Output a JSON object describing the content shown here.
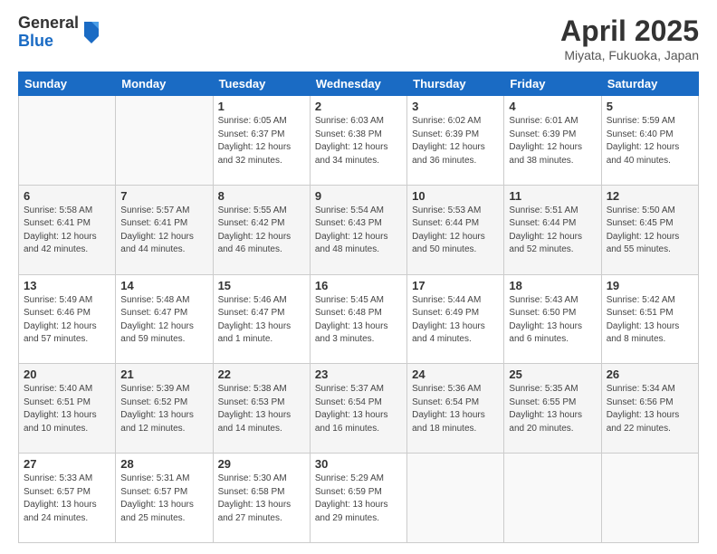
{
  "header": {
    "logo_general": "General",
    "logo_blue": "Blue",
    "title": "April 2025",
    "location": "Miyata, Fukuoka, Japan"
  },
  "columns": [
    "Sunday",
    "Monday",
    "Tuesday",
    "Wednesday",
    "Thursday",
    "Friday",
    "Saturday"
  ],
  "weeks": [
    [
      {
        "day": "",
        "info": ""
      },
      {
        "day": "",
        "info": ""
      },
      {
        "day": "1",
        "info": "Sunrise: 6:05 AM\nSunset: 6:37 PM\nDaylight: 12 hours\nand 32 minutes."
      },
      {
        "day": "2",
        "info": "Sunrise: 6:03 AM\nSunset: 6:38 PM\nDaylight: 12 hours\nand 34 minutes."
      },
      {
        "day": "3",
        "info": "Sunrise: 6:02 AM\nSunset: 6:39 PM\nDaylight: 12 hours\nand 36 minutes."
      },
      {
        "day": "4",
        "info": "Sunrise: 6:01 AM\nSunset: 6:39 PM\nDaylight: 12 hours\nand 38 minutes."
      },
      {
        "day": "5",
        "info": "Sunrise: 5:59 AM\nSunset: 6:40 PM\nDaylight: 12 hours\nand 40 minutes."
      }
    ],
    [
      {
        "day": "6",
        "info": "Sunrise: 5:58 AM\nSunset: 6:41 PM\nDaylight: 12 hours\nand 42 minutes."
      },
      {
        "day": "7",
        "info": "Sunrise: 5:57 AM\nSunset: 6:41 PM\nDaylight: 12 hours\nand 44 minutes."
      },
      {
        "day": "8",
        "info": "Sunrise: 5:55 AM\nSunset: 6:42 PM\nDaylight: 12 hours\nand 46 minutes."
      },
      {
        "day": "9",
        "info": "Sunrise: 5:54 AM\nSunset: 6:43 PM\nDaylight: 12 hours\nand 48 minutes."
      },
      {
        "day": "10",
        "info": "Sunrise: 5:53 AM\nSunset: 6:44 PM\nDaylight: 12 hours\nand 50 minutes."
      },
      {
        "day": "11",
        "info": "Sunrise: 5:51 AM\nSunset: 6:44 PM\nDaylight: 12 hours\nand 52 minutes."
      },
      {
        "day": "12",
        "info": "Sunrise: 5:50 AM\nSunset: 6:45 PM\nDaylight: 12 hours\nand 55 minutes."
      }
    ],
    [
      {
        "day": "13",
        "info": "Sunrise: 5:49 AM\nSunset: 6:46 PM\nDaylight: 12 hours\nand 57 minutes."
      },
      {
        "day": "14",
        "info": "Sunrise: 5:48 AM\nSunset: 6:47 PM\nDaylight: 12 hours\nand 59 minutes."
      },
      {
        "day": "15",
        "info": "Sunrise: 5:46 AM\nSunset: 6:47 PM\nDaylight: 13 hours\nand 1 minute."
      },
      {
        "day": "16",
        "info": "Sunrise: 5:45 AM\nSunset: 6:48 PM\nDaylight: 13 hours\nand 3 minutes."
      },
      {
        "day": "17",
        "info": "Sunrise: 5:44 AM\nSunset: 6:49 PM\nDaylight: 13 hours\nand 4 minutes."
      },
      {
        "day": "18",
        "info": "Sunrise: 5:43 AM\nSunset: 6:50 PM\nDaylight: 13 hours\nand 6 minutes."
      },
      {
        "day": "19",
        "info": "Sunrise: 5:42 AM\nSunset: 6:51 PM\nDaylight: 13 hours\nand 8 minutes."
      }
    ],
    [
      {
        "day": "20",
        "info": "Sunrise: 5:40 AM\nSunset: 6:51 PM\nDaylight: 13 hours\nand 10 minutes."
      },
      {
        "day": "21",
        "info": "Sunrise: 5:39 AM\nSunset: 6:52 PM\nDaylight: 13 hours\nand 12 minutes."
      },
      {
        "day": "22",
        "info": "Sunrise: 5:38 AM\nSunset: 6:53 PM\nDaylight: 13 hours\nand 14 minutes."
      },
      {
        "day": "23",
        "info": "Sunrise: 5:37 AM\nSunset: 6:54 PM\nDaylight: 13 hours\nand 16 minutes."
      },
      {
        "day": "24",
        "info": "Sunrise: 5:36 AM\nSunset: 6:54 PM\nDaylight: 13 hours\nand 18 minutes."
      },
      {
        "day": "25",
        "info": "Sunrise: 5:35 AM\nSunset: 6:55 PM\nDaylight: 13 hours\nand 20 minutes."
      },
      {
        "day": "26",
        "info": "Sunrise: 5:34 AM\nSunset: 6:56 PM\nDaylight: 13 hours\nand 22 minutes."
      }
    ],
    [
      {
        "day": "27",
        "info": "Sunrise: 5:33 AM\nSunset: 6:57 PM\nDaylight: 13 hours\nand 24 minutes."
      },
      {
        "day": "28",
        "info": "Sunrise: 5:31 AM\nSunset: 6:57 PM\nDaylight: 13 hours\nand 25 minutes."
      },
      {
        "day": "29",
        "info": "Sunrise: 5:30 AM\nSunset: 6:58 PM\nDaylight: 13 hours\nand 27 minutes."
      },
      {
        "day": "30",
        "info": "Sunrise: 5:29 AM\nSunset: 6:59 PM\nDaylight: 13 hours\nand 29 minutes."
      },
      {
        "day": "",
        "info": ""
      },
      {
        "day": "",
        "info": ""
      },
      {
        "day": "",
        "info": ""
      }
    ]
  ]
}
